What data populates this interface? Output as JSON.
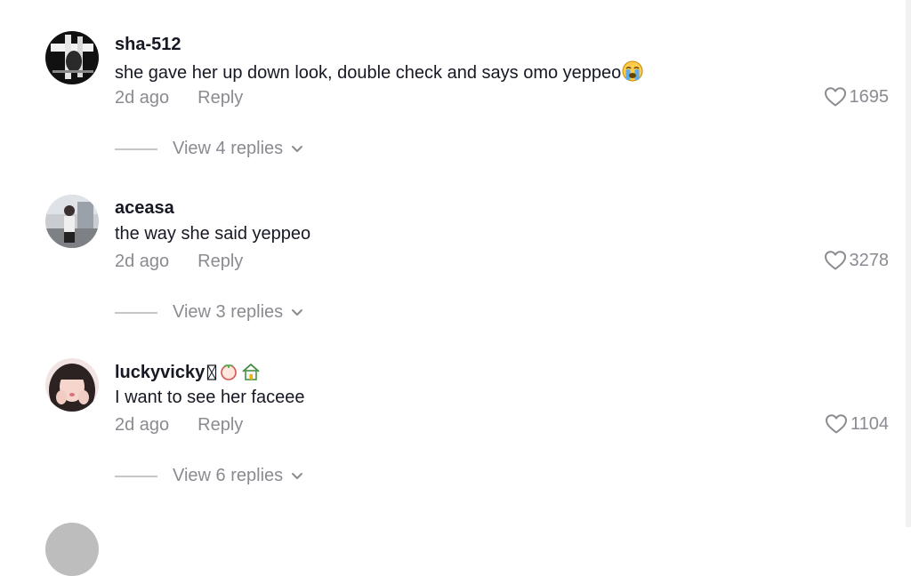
{
  "comments": [
    {
      "username": "sha-512",
      "text": "she gave her up down look, double check and says omo yeppeo",
      "time": "2d ago",
      "reply_label": "Reply",
      "likes": "1695",
      "view_replies": "View 4 replies"
    },
    {
      "username": "aceasa",
      "text": "the way she said yeppeo",
      "time": "2d ago",
      "reply_label": "Reply",
      "likes": "3278",
      "view_replies": "View 3 replies"
    },
    {
      "username": "luckyvicky",
      "text": "I want to see her faceee",
      "time": "2d ago",
      "reply_label": "Reply",
      "likes": "1104",
      "view_replies": "View 6 replies"
    }
  ],
  "icons": {
    "emoji": "loudly-crying-face-icon",
    "like": "heart-outline-icon",
    "expand": "chevron-down-icon",
    "name_badges": [
      "missing-glyph-icon",
      "peach-icon",
      "house-icon"
    ]
  },
  "colors": {
    "primary_text": "#161823",
    "secondary_text": "#8a8b91"
  }
}
